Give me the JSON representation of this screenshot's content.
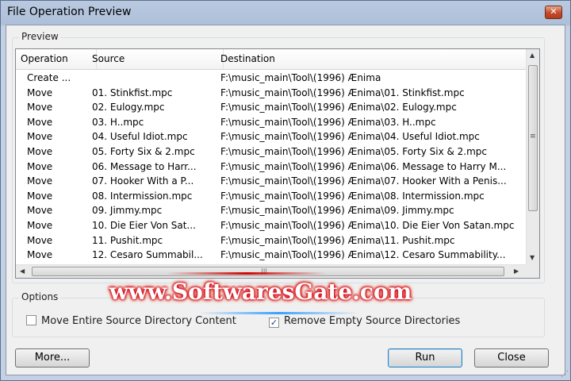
{
  "window": {
    "title": "File Operation Preview",
    "close_glyph": "✕"
  },
  "preview": {
    "group_label": "Preview",
    "columns": [
      "Operation",
      "Source",
      "Destination"
    ],
    "rows": [
      [
        "Create ...",
        "",
        "F:\\music_main\\Tool\\(1996) Ænima"
      ],
      [
        "Move",
        "01. Stinkfist.mpc",
        "F:\\music_main\\Tool\\(1996) Ænima\\01. Stinkfist.mpc"
      ],
      [
        "Move",
        "02. Eulogy.mpc",
        "F:\\music_main\\Tool\\(1996) Ænima\\02. Eulogy.mpc"
      ],
      [
        "Move",
        "03. H..mpc",
        "F:\\music_main\\Tool\\(1996) Ænima\\03. H..mpc"
      ],
      [
        "Move",
        "04. Useful Idiot.mpc",
        "F:\\music_main\\Tool\\(1996) Ænima\\04. Useful Idiot.mpc"
      ],
      [
        "Move",
        "05. Forty Six & 2.mpc",
        "F:\\music_main\\Tool\\(1996) Ænima\\05. Forty Six & 2.mpc"
      ],
      [
        "Move",
        "06. Message to Harr...",
        "F:\\music_main\\Tool\\(1996) Ænima\\06. Message to Harry M..."
      ],
      [
        "Move",
        "07. Hooker With a P...",
        "F:\\music_main\\Tool\\(1996) Ænima\\07. Hooker With a Penis..."
      ],
      [
        "Move",
        "08. Intermission.mpc",
        "F:\\music_main\\Tool\\(1996) Ænima\\08. Intermission.mpc"
      ],
      [
        "Move",
        "09. Jimmy.mpc",
        "F:\\music_main\\Tool\\(1996) Ænima\\09. Jimmy.mpc"
      ],
      [
        "Move",
        "10. Die Eier Von Sat...",
        "F:\\music_main\\Tool\\(1996) Ænima\\10. Die Eier Von Satan.mpc"
      ],
      [
        "Move",
        "11. Pushit.mpc",
        "F:\\music_main\\Tool\\(1996) Ænima\\11. Pushit.mpc"
      ],
      [
        "Move",
        "12. Cesaro Summabil...",
        "F:\\music_main\\Tool\\(1996) Ænima\\12. Cesaro Summability..."
      ]
    ]
  },
  "options": {
    "group_label": "Options",
    "move_entire": {
      "label": "Move Entire Source Directory Content",
      "checked": false
    },
    "remove_empty": {
      "label": "Remove Empty Source Directories",
      "checked": true
    }
  },
  "buttons": {
    "more": "More...",
    "run": "Run",
    "close": "Close"
  },
  "watermark": "www.SoftwaresGate.com",
  "icons": {
    "check": "✓",
    "arrow_up": "▲",
    "arrow_down": "▼",
    "arrow_left": "◀",
    "arrow_right": "▶",
    "grip_v": "≡",
    "grip_h": "|||",
    "resize": "⋰"
  }
}
